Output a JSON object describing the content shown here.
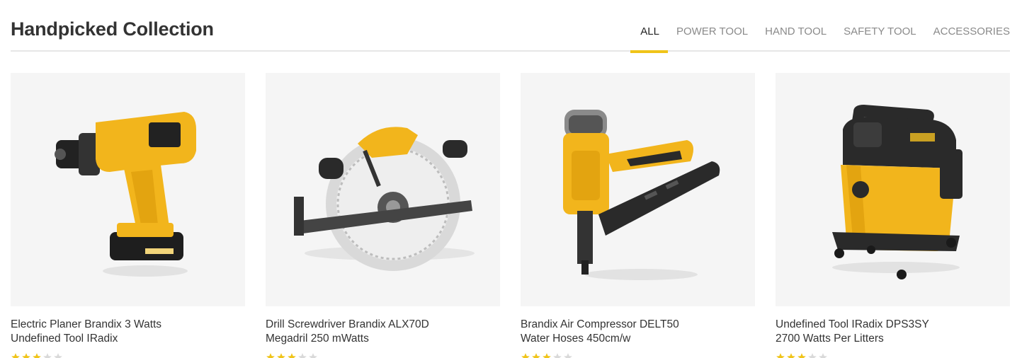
{
  "section": {
    "title": "Handpicked Collection",
    "tabs": [
      {
        "label": "All",
        "active": true
      },
      {
        "label": "Power Tool",
        "active": false
      },
      {
        "label": "Hand Tool",
        "active": false
      },
      {
        "label": "Safety Tool",
        "active": false
      },
      {
        "label": "Accessories",
        "active": false
      }
    ]
  },
  "colors": {
    "accent": "#f0c419",
    "tool_yellow": "#f2b51c",
    "card_bg": "#f5f5f5"
  },
  "products": [
    {
      "name_line1": "Electric Planer Brandix 3 Watts",
      "name_line2": "Undefined Tool IRadix",
      "rating": 3,
      "icon": "cordless-drill-icon"
    },
    {
      "name_line1": "Drill Screwdriver Brandix ALX70D",
      "name_line2": "Megadril 250 mWatts",
      "rating": 3,
      "icon": "circular-saw-icon"
    },
    {
      "name_line1": "Brandix Air Compressor DELT50",
      "name_line2": "Water Hoses 450cm/w",
      "rating": 3,
      "icon": "nail-gun-icon"
    },
    {
      "name_line1": "Undefined Tool IRadix DPS3SY",
      "name_line2": "2700 Watts Per Litters",
      "rating": 3,
      "icon": "wet-dry-vacuum-icon"
    }
  ]
}
